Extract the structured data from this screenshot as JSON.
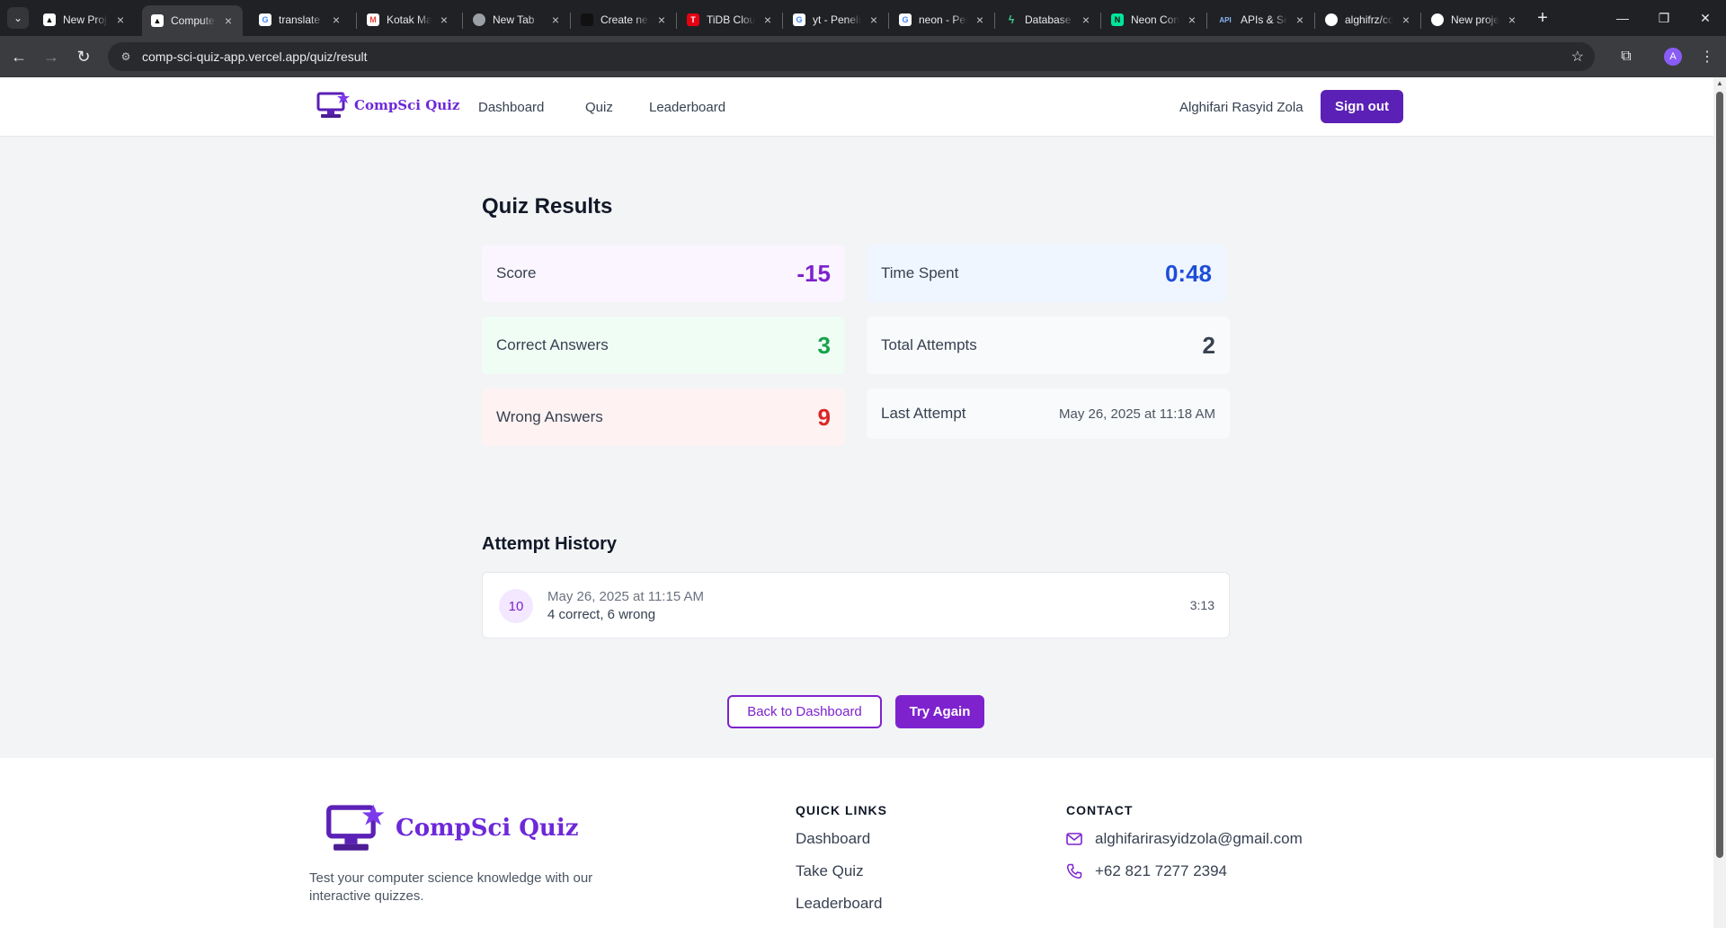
{
  "browser": {
    "tabs": [
      {
        "title": "New Project",
        "favicon": "triangle-logo-icon",
        "color": "#000000"
      },
      {
        "title": "Computer Science Quiz",
        "favicon": "triangle-logo-icon",
        "color": "#000000",
        "active": true
      },
      {
        "title": "translate",
        "favicon": "google-icon",
        "color": "#4285f4"
      },
      {
        "title": "Kotak Masuk",
        "favicon": "gmail-icon",
        "color": "#ea4335"
      },
      {
        "title": "New Tab",
        "favicon": "chrome-icon",
        "color": "#9aa0a6"
      },
      {
        "title": "Create new",
        "favicon": "dark-square-icon",
        "color": "#111111"
      },
      {
        "title": "TiDB Cloud",
        "favicon": "tidb-icon",
        "color": "#e60012"
      },
      {
        "title": "yt - Penelusuran",
        "favicon": "google-icon",
        "color": "#4285f4"
      },
      {
        "title": "neon - Penelusuran",
        "favicon": "google-icon",
        "color": "#4285f4"
      },
      {
        "title": "Database",
        "favicon": "bolt-icon",
        "color": "#3ecf8e"
      },
      {
        "title": "Neon Console",
        "favicon": "neon-icon",
        "color": "#00e599"
      },
      {
        "title": "APIs & Services",
        "favicon": "api-icon",
        "color": "#8ab4f8"
      },
      {
        "title": "alghifrz/comp-sci-quiz",
        "favicon": "github-icon",
        "color": "#ffffff"
      },
      {
        "title": "New project",
        "favicon": "circle-logo-icon",
        "color": "#ffffff"
      }
    ],
    "url": "comp-sci-quiz-app.vercel.app/quiz/result",
    "profile_initial": "A"
  },
  "header": {
    "brand": "CompSci Quiz",
    "nav": [
      "Dashboard",
      "Quiz",
      "Leaderboard"
    ],
    "user_name": "Alghifari Rasyid Zola",
    "sign_out_label": "Sign out"
  },
  "results": {
    "title": "Quiz Results",
    "score": {
      "label": "Score",
      "value": "-15",
      "color": "#7e22ce",
      "bg": "#faf5ff"
    },
    "time_spent": {
      "label": "Time Spent",
      "value": "0:48",
      "color": "#1d4ed8",
      "bg": "#eff6ff"
    },
    "correct": {
      "label": "Correct Answers",
      "value": "3",
      "color": "#16a34a",
      "bg": "#f0fdf4"
    },
    "total_attempts": {
      "label": "Total Attempts",
      "value": "2",
      "color": "#374151",
      "bg": "#f9fafb"
    },
    "wrong": {
      "label": "Wrong Answers",
      "value": "9",
      "color": "#dc2626",
      "bg": "#fef2f2"
    },
    "last_attempt": {
      "label": "Last Attempt",
      "value": "May 26, 2025 at 11:18 AM",
      "bg": "#f9fafb"
    }
  },
  "history": {
    "title": "Attempt History",
    "attempts": [
      {
        "score": "10",
        "date": "May 26, 2025 at 11:15 AM",
        "summary": "4 correct, 6 wrong",
        "duration": "3:13"
      }
    ]
  },
  "actions": {
    "back_label": "Back to Dashboard",
    "retry_label": "Try Again"
  },
  "footer": {
    "brand": "CompSci Quiz",
    "description": "Test your computer science knowledge with our interactive quizzes.",
    "quick_links_title": "QUICK LINKS",
    "quick_links": [
      "Dashboard",
      "Take Quiz",
      "Leaderboard"
    ],
    "contact_title": "CONTACT",
    "email": "alghifarirasyidzola@gmail.com",
    "phone": "+62 821 7277 2394"
  },
  "colors": {
    "accent": "#7e22ce",
    "brand": "#6d28d9"
  }
}
